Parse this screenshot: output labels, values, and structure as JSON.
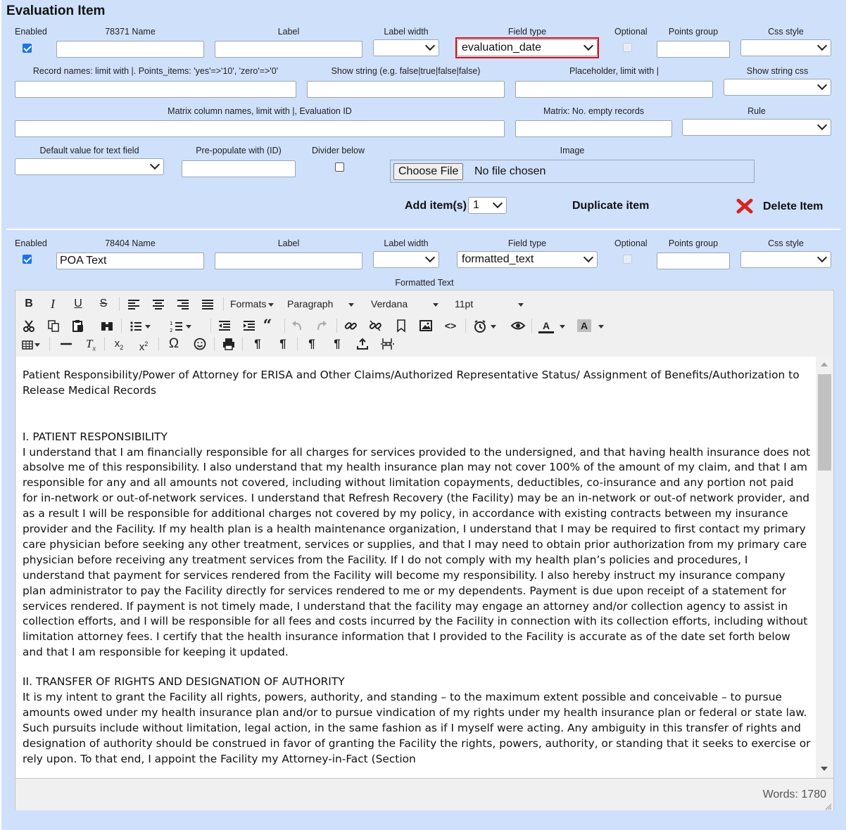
{
  "header": {
    "title": "Evaluation Item"
  },
  "labels": {
    "enabled": "Enabled",
    "label": "Label",
    "label_width": "Label width",
    "field_type": "Field type",
    "optional": "Optional",
    "points_group": "Points group",
    "css_style": "Css style",
    "record_names": "Record names: limit with |. Points_items: 'yes'=>'10', 'zero'=>'0'",
    "show_string": "Show string (e.g. false|true|false|false)",
    "placeholder": "Placeholder, limit with |",
    "show_string_css": "Show string css",
    "matrix_columns": "Matrix column names, limit with |, Evaluation ID",
    "matrix_empty": "Matrix: No. empty records",
    "rule": "Rule",
    "default_value": "Default value for text field",
    "prepopulate": "Pre-populate with (ID)",
    "divider_below": "Divider below",
    "image": "Image",
    "formatted_text": "Formatted Text"
  },
  "item1": {
    "name_label": "78371 Name",
    "name_value": "",
    "field_type": "evaluation_date",
    "file_button": "Choose File",
    "file_status": "No file chosen",
    "add_items_label": "Add item(s)",
    "add_items_count": "1",
    "duplicate": "Duplicate item",
    "delete": "Delete Item"
  },
  "item2": {
    "name_label": "78404 Name",
    "name_value": "POA Text",
    "field_type": "formatted_text"
  },
  "editor": {
    "formats": "Formats",
    "paragraph": "Paragraph",
    "font": "Verdana",
    "size": "11pt",
    "words": "Words: 1780",
    "paragraphs": [
      "Patient Responsibility/Power of Attorney for ERISA and Other Claims/Authorized Representative Status/ Assignment of Benefits/Authorization to Release Medical Records",
      "",
      "I. PATIENT RESPONSIBILITY",
      "I understand that I am financially responsible for all charges for services provided to the undersigned, and that having health insurance does not absolve me of this responsibility. I also understand that my health insurance plan may not cover 100% of the amount of my claim, and that I am responsible for any and all amounts not covered, including without limitation copayments, deductibles, co-insurance and any portion not paid for in-network or out-of-network services. I understand that Refresh Recovery (the Facility) may be an in-network or out-of network provider, and as a result I will be responsible for additional charges not covered by my policy, in accordance with existing contracts between my insurance provider and the Facility. If my health plan is a health maintenance organization, I understand that I may be required to first contact my primary care physician before seeking any other treatment, services or supplies, and that I may need to obtain prior authorization from my primary care physician before receiving any treatment services from the Facility. If I do not comply with my health plan’s policies and procedures, I understand that payment for services rendered from the Facility will become my responsibility. I also hereby instruct my insurance company plan administrator to pay the Facility directly for services rendered to me or my dependents. Payment is due upon receipt of a statement for services rendered. If payment is not timely made, I understand that the facility may engage an attorney and/or collection agency to assist in collection efforts, and I will be responsible for all fees and costs incurred by the Facility in connection with its collection efforts, including without limitation attorney fees. I certify that the health insurance information that I provided to the Facility is accurate as of the date set forth below and that I am responsible for keeping it updated.",
      "II. TRANSFER OF RIGHTS AND DESIGNATION OF AUTHORITY",
      "It is my intent to grant the Facility all rights, powers, authority, and standing – to the maximum extent possible and conceivable – to pursue amounts owed under my health insurance plan and/or to pursue vindication of my rights under my health insurance plan or federal or state law. Such pursuits include without limitation, legal action, in the same fashion as if I myself were acting. Any ambiguity in this transfer of rights and designation of authority should be construed in favor of granting the Facility the rights, powers, authority, or standing that it seeks to exercise or rely upon. To that end, I appoint the Facility my Attorney-in-Fact (Section"
    ]
  },
  "colors": {
    "panel": "#cfe0fb",
    "highlight": "#e01010",
    "checkbox": "#1a73e8",
    "delete_icon": "#d9231d"
  }
}
